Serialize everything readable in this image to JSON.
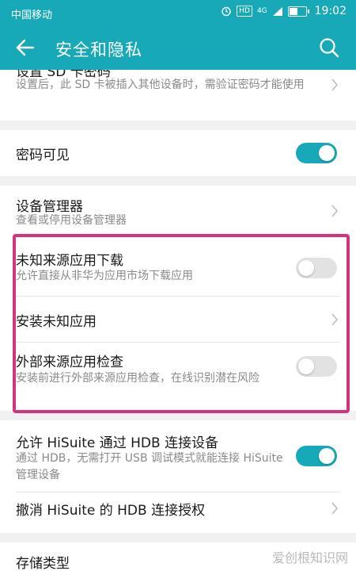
{
  "status_bar": {
    "carrier": "中国移动",
    "network": "4G",
    "hd_badge": "HD",
    "time": "19:02",
    "battery_level": 0.55
  },
  "appbar": {
    "title": "安全和隐私"
  },
  "items": {
    "sd_password": {
      "title": "设置 SD 卡密码",
      "subtitle": "设置后，此 SD 卡被插入其他设备时，需验证密码才能使用"
    },
    "password_visible": {
      "title": "密码可见",
      "toggle_on": true
    },
    "device_manager": {
      "title": "设备管理器",
      "subtitle": "查看或停用设备管理器"
    },
    "unknown_sources": {
      "title": "未知来源应用下载",
      "subtitle": "允许直接从非华为应用市场下载应用",
      "toggle_on": false
    },
    "install_unknown": {
      "title": "安装未知应用"
    },
    "external_check": {
      "title": "外部来源应用检查",
      "subtitle": "安装前进行外部来源应用检查，在线识别潜在风险",
      "toggle_on": false
    },
    "hisuite_allow": {
      "title": "允许 HiSuite 通过 HDB 连接设备",
      "subtitle": "通过 HDB，无需打开 USB 调试模式就能连接 HiSuite 管理设备",
      "toggle_on": true
    },
    "hisuite_revoke": {
      "title": "撤消 HiSuite 的 HDB 连接授权"
    },
    "storage_type": {
      "title": "存储类型"
    }
  },
  "colors": {
    "accent": "#17a9b8",
    "highlight": "#d6337d"
  },
  "watermark": "爱创根知识网"
}
